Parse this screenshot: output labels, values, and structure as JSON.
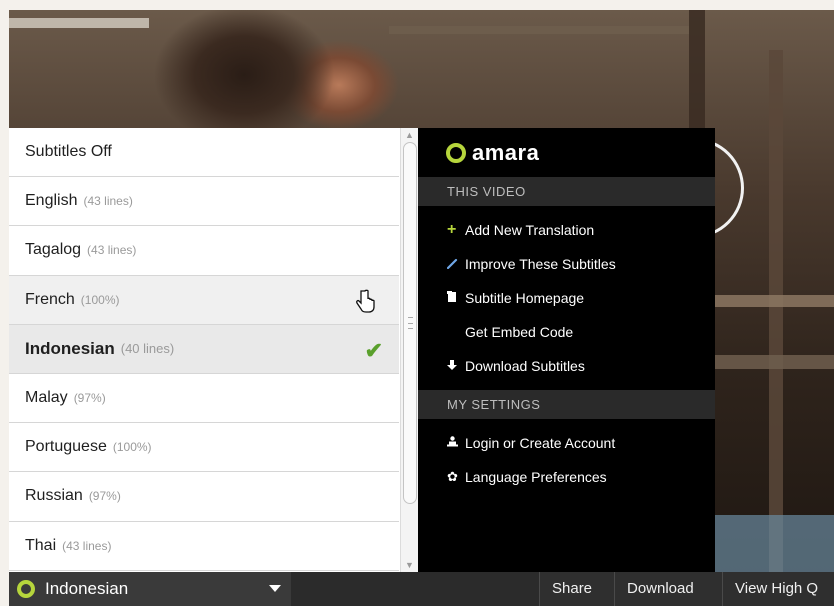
{
  "languages": [
    {
      "name": "Subtitles Off",
      "meta": ""
    },
    {
      "name": "English",
      "meta": "(43 lines)"
    },
    {
      "name": "Tagalog",
      "meta": "(43 lines)"
    },
    {
      "name": "French",
      "meta": "(100%)"
    },
    {
      "name": "Indonesian",
      "meta": "(40 lines)"
    },
    {
      "name": "Malay",
      "meta": "(97%)"
    },
    {
      "name": "Portuguese",
      "meta": "(100%)"
    },
    {
      "name": "Russian",
      "meta": "(97%)"
    },
    {
      "name": "Thai",
      "meta": "(43 lines)"
    }
  ],
  "amara": {
    "brand": "amara",
    "this_video_header": "THIS VIDEO",
    "my_settings_header": "MY SETTINGS",
    "video_items": [
      {
        "label": "Add New Translation",
        "icon": "plus-icon"
      },
      {
        "label": "Improve These Subtitles",
        "icon": "pencil-icon"
      },
      {
        "label": "Subtitle Homepage",
        "icon": "document-icon"
      },
      {
        "label": "Get Embed Code",
        "icon": ""
      },
      {
        "label": "Download Subtitles",
        "icon": "download-arrow-icon"
      }
    ],
    "settings_items": [
      {
        "label": "Login or Create Account",
        "icon": "user-icon"
      },
      {
        "label": "Language Preferences",
        "icon": "gear-icon"
      }
    ]
  },
  "bottom_bar": {
    "selected_language": "Indonesian",
    "share": "Share",
    "download": "Download",
    "view_hq": "View High Q"
  },
  "colors": {
    "accent": "#b6d53c",
    "check": "#5aa02c",
    "menu_bg": "#000000"
  }
}
